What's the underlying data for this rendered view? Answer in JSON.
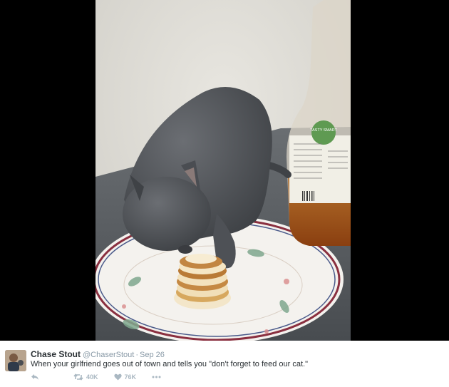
{
  "tweet": {
    "name": "Chase Stout",
    "handle": "@ChaserStout",
    "separator": "·",
    "date": "Sep 26",
    "text": "When your girlfriend goes out of town and tells you \"don't forget to feed our cat.\"",
    "retweet_count": "40K",
    "like_count": "76K"
  },
  "photo": {
    "syrup_brand": "TASTY SMART"
  },
  "colors": {
    "name": "#292f33",
    "muted": "#8899a6",
    "action_icon": "#aab8c2"
  },
  "icons": [
    "reply-icon",
    "retweet-icon",
    "heart-icon",
    "more-icon"
  ]
}
